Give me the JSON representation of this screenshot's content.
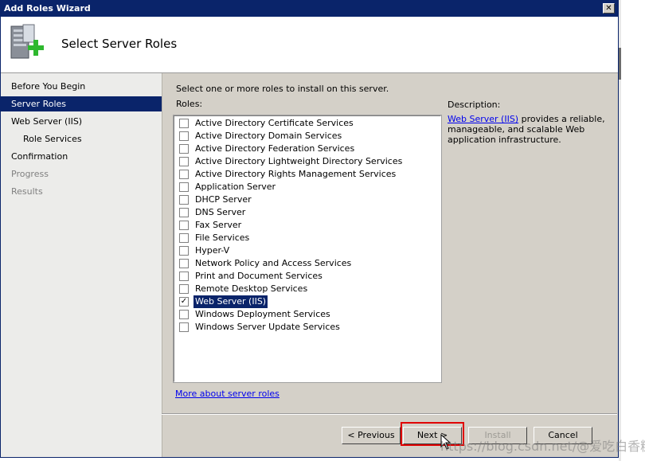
{
  "window": {
    "title": "Add Roles Wizard",
    "close_glyph": "✕"
  },
  "header": {
    "title": "Select Server Roles",
    "icon": "server-add-icon"
  },
  "nav": {
    "items": [
      {
        "label": "Before You Begin",
        "state": "normal",
        "sub": false
      },
      {
        "label": "Server Roles",
        "state": "selected",
        "sub": false
      },
      {
        "label": "Web Server (IIS)",
        "state": "normal",
        "sub": false
      },
      {
        "label": "Role Services",
        "state": "normal",
        "sub": true
      },
      {
        "label": "Confirmation",
        "state": "normal",
        "sub": false
      },
      {
        "label": "Progress",
        "state": "disabled",
        "sub": false
      },
      {
        "label": "Results",
        "state": "disabled",
        "sub": false
      }
    ]
  },
  "main": {
    "instruction": "Select one or more roles to install on this server.",
    "roles_label": "Roles:",
    "roles": [
      {
        "label": "Active Directory Certificate Services",
        "checked": false
      },
      {
        "label": "Active Directory Domain Services",
        "checked": false
      },
      {
        "label": "Active Directory Federation Services",
        "checked": false
      },
      {
        "label": "Active Directory Lightweight Directory Services",
        "checked": false
      },
      {
        "label": "Active Directory Rights Management Services",
        "checked": false
      },
      {
        "label": "Application Server",
        "checked": false
      },
      {
        "label": "DHCP Server",
        "checked": false
      },
      {
        "label": "DNS Server",
        "checked": false
      },
      {
        "label": "Fax Server",
        "checked": false
      },
      {
        "label": "File Services",
        "checked": false
      },
      {
        "label": "Hyper-V",
        "checked": false
      },
      {
        "label": "Network Policy and Access Services",
        "checked": false
      },
      {
        "label": "Print and Document Services",
        "checked": false
      },
      {
        "label": "Remote Desktop Services",
        "checked": false
      },
      {
        "label": "Web Server (IIS)",
        "checked": true
      },
      {
        "label": "Windows Deployment Services",
        "checked": false
      },
      {
        "label": "Windows Server Update Services",
        "checked": false
      }
    ],
    "more_link": "More about server roles",
    "description_label": "Description:",
    "description_link": "Web Server (IIS)",
    "description_text": " provides a reliable, manageable, and scalable Web application infrastructure."
  },
  "buttons": {
    "previous": "< Previous",
    "next": "Next >",
    "install": "Install",
    "cancel": "Cancel"
  },
  "watermark": "https://blog.csdn.net/@爱吃白香糖",
  "colors": {
    "selection": "#0a246a",
    "link": "#0000ee",
    "highlight": "#e00000"
  }
}
